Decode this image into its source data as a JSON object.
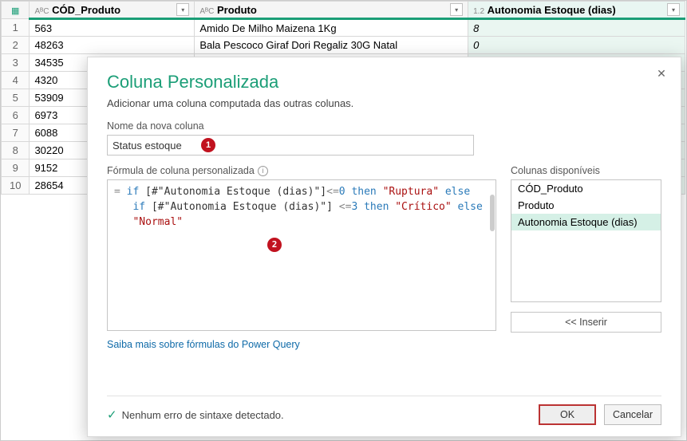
{
  "columns": {
    "cod": {
      "type": "AᴮC",
      "label": "CÓD_Produto"
    },
    "prod": {
      "type": "AᴮC",
      "label": "Produto"
    },
    "aut": {
      "type": "1.2",
      "label": "Autonomia Estoque (dias)"
    }
  },
  "rows": [
    {
      "n": "1",
      "cod": "563",
      "prod": "Amido De Milho Maizena 1Kg",
      "aut": "8"
    },
    {
      "n": "2",
      "cod": "48263",
      "prod": "Bala Pescoco Giraf Dori Regaliz 30G Natal",
      "aut": "0"
    },
    {
      "n": "3",
      "cod": "34535",
      "prod": "",
      "aut": ""
    },
    {
      "n": "4",
      "cod": "4320",
      "prod": "",
      "aut": ""
    },
    {
      "n": "5",
      "cod": "53909",
      "prod": "",
      "aut": ""
    },
    {
      "n": "6",
      "cod": "6973",
      "prod": "",
      "aut": ""
    },
    {
      "n": "7",
      "cod": "6088",
      "prod": "",
      "aut": ""
    },
    {
      "n": "8",
      "cod": "30220",
      "prod": "",
      "aut": ""
    },
    {
      "n": "9",
      "cod": "9152",
      "prod": "",
      "aut": ""
    },
    {
      "n": "10",
      "cod": "28654",
      "prod": "",
      "aut": ""
    }
  ],
  "dialog": {
    "title": "Coluna Personalizada",
    "subtitle": "Adicionar uma coluna computada das outras colunas.",
    "name_label": "Nome da nova coluna",
    "name_value": "Status estoque",
    "formula_label": "Fórmula de coluna personalizada",
    "formula_tokens": {
      "eq": "= ",
      "if": "if",
      "field1": "[#\"Autonomia Estoque (dias)\"]",
      "op1": "<=",
      "v0": "0",
      "then": "then",
      "s_rupt": "\"Ruptura\"",
      "else": "else",
      "field2": "[#\"Autonomia Estoque (dias)\"]",
      "op2": " <=",
      "v3": "3",
      "s_crit": "\"Crítico\"",
      "s_norm": "\"Normal\""
    },
    "learn_link": "Saiba mais sobre fórmulas do Power Query",
    "avail_label": "Colunas disponíveis",
    "avail": [
      {
        "label": "CÓD_Produto",
        "sel": false
      },
      {
        "label": "Produto",
        "sel": false
      },
      {
        "label": "Autonomia Estoque (dias)",
        "sel": true
      }
    ],
    "insert_label": "<< Inserir",
    "syntax_ok": "Nenhum erro de sintaxe detectado.",
    "ok": "OK",
    "cancel": "Cancelar",
    "badge1": "1",
    "badge2": "2"
  }
}
